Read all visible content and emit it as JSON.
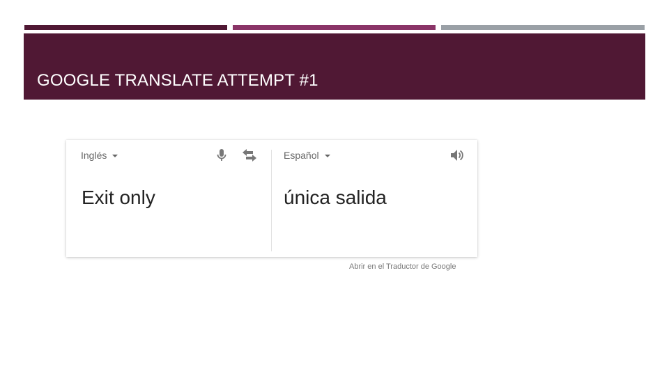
{
  "slide": {
    "title": "GOOGLE TRANSLATE ATTEMPT #1",
    "colors": {
      "band": "#501834",
      "stripe_1": "#501834",
      "stripe_2": "#8a3467",
      "stripe_3": "#9aa0a6"
    }
  },
  "translator": {
    "source": {
      "language": "Inglés",
      "text": "Exit only",
      "icons": [
        "mic-icon",
        "swap-icon"
      ]
    },
    "target": {
      "language": "Español",
      "text": "única salida",
      "icons": [
        "speaker-icon"
      ]
    },
    "open_link": "Abrir en el Traductor de Google"
  }
}
